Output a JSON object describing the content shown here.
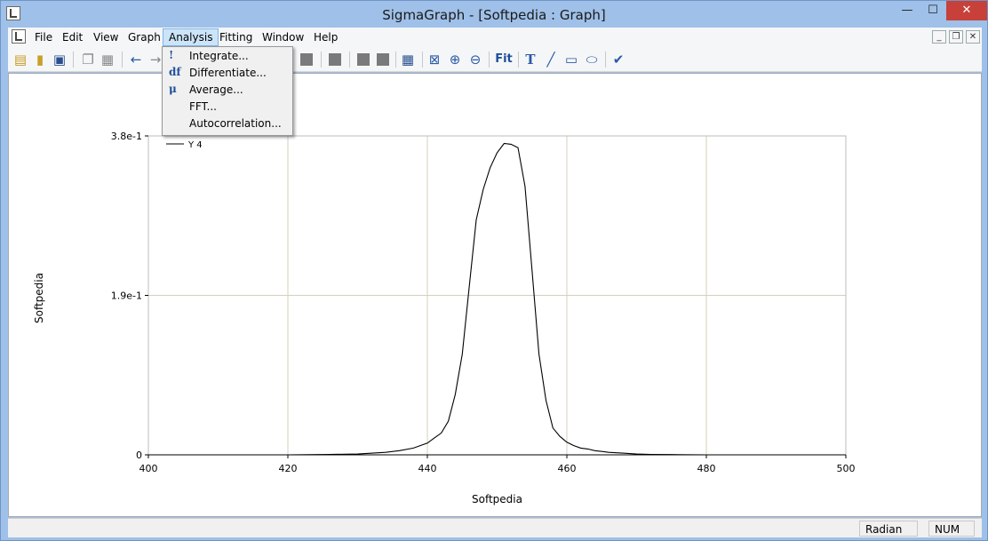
{
  "window": {
    "title": "SigmaGraph - [Softpedia : Graph]"
  },
  "menubar": {
    "items": [
      "File",
      "Edit",
      "View",
      "Graph",
      "Analysis",
      "Fitting",
      "Window",
      "Help"
    ]
  },
  "analysis_menu": {
    "items": [
      {
        "icon": "!",
        "label": "Integrate..."
      },
      {
        "icon": "df",
        "label": "Differentiate..."
      },
      {
        "icon": "μ",
        "label": "Average..."
      },
      {
        "icon": "",
        "label": "FFT..."
      },
      {
        "icon": "",
        "label": "Autocorrelation..."
      }
    ]
  },
  "toolbar": {
    "fit_label": "Fit",
    "text_label": "T"
  },
  "status": {
    "angle_mode": "Radian",
    "num": "NUM"
  },
  "chart_data": {
    "type": "line",
    "xlabel": "Softpedia",
    "ylabel": "Softpedia",
    "xlim": [
      400,
      500
    ],
    "ylim": [
      0,
      0.38
    ],
    "xticks": [
      "400",
      "420",
      "440",
      "460",
      "480",
      "500"
    ],
    "yticks": [
      "0",
      "1.9e-1",
      "3.8e-1"
    ],
    "grid": true,
    "legend": "top-left",
    "series": [
      {
        "name": "Y 4",
        "color": "#000000",
        "x": [
          400,
          420,
          426,
          430,
          434,
          436,
          438,
          440,
          441,
          442,
          443,
          444,
          445,
          446,
          447,
          448,
          449,
          450,
          451,
          452,
          453,
          454,
          455,
          456,
          457,
          458,
          459,
          460,
          461,
          462,
          463,
          464,
          465,
          466,
          468,
          470,
          472,
          475,
          480,
          500
        ],
        "y": [
          0,
          0,
          0.0005,
          0.001,
          0.003,
          0.005,
          0.008,
          0.014,
          0.02,
          0.026,
          0.04,
          0.072,
          0.12,
          0.2,
          0.28,
          0.316,
          0.342,
          0.36,
          0.371,
          0.37,
          0.366,
          0.32,
          0.22,
          0.12,
          0.065,
          0.032,
          0.022,
          0.015,
          0.011,
          0.008,
          0.007,
          0.005,
          0.004,
          0.003,
          0.002,
          0.001,
          0.0005,
          0.0003,
          0,
          0
        ]
      }
    ]
  }
}
